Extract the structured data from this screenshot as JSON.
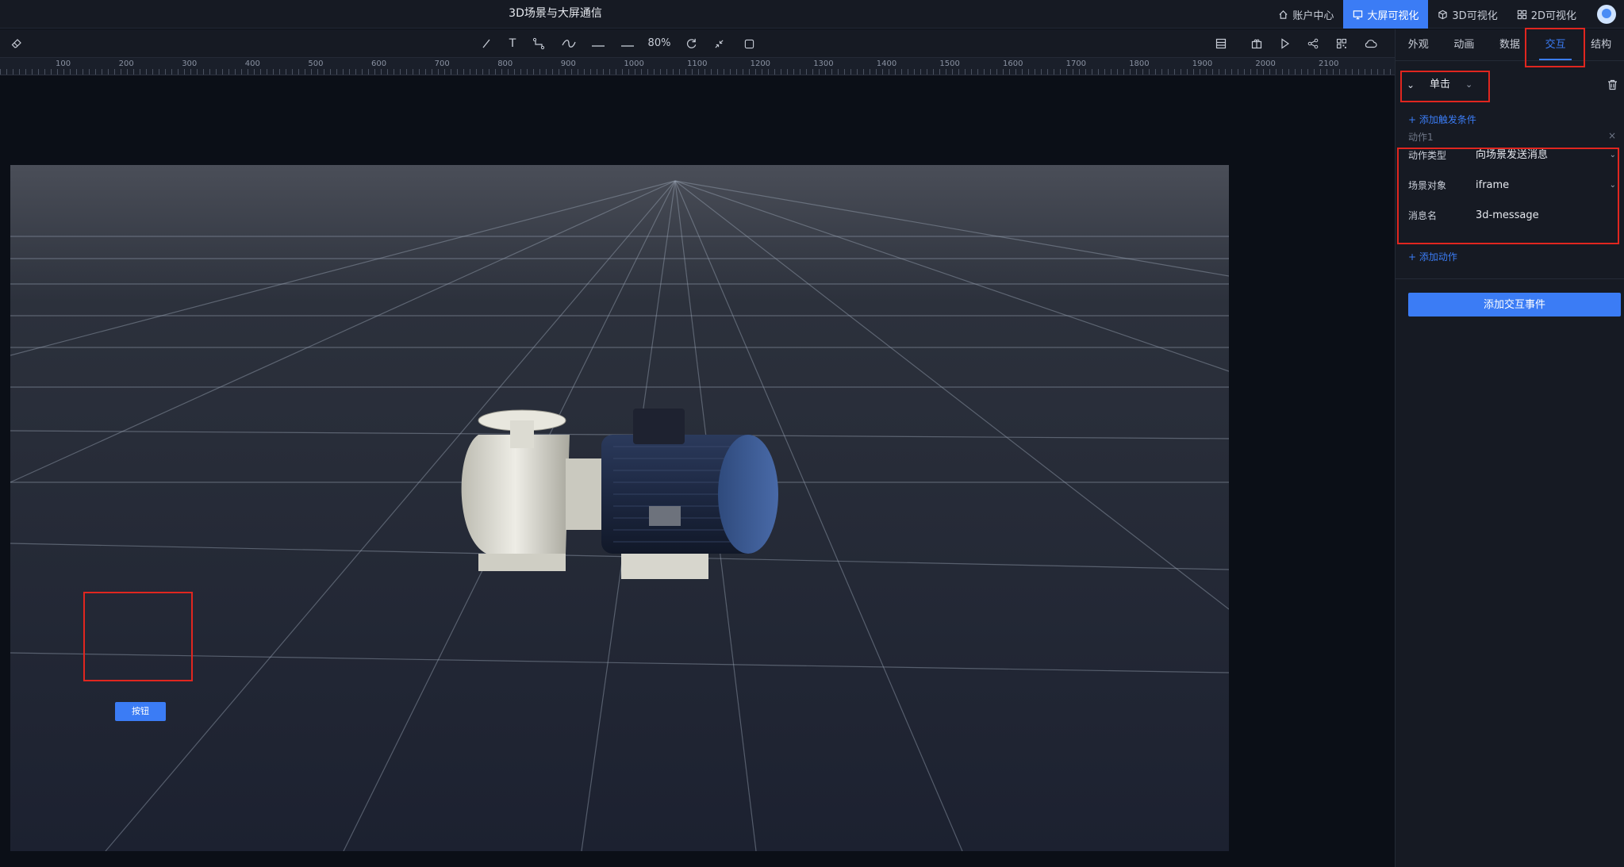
{
  "header": {
    "title": "3D场景与大屏通信",
    "nav": [
      {
        "label": "账户中心",
        "icon": "home-icon"
      },
      {
        "label": "大屏可视化",
        "icon": "monitor-icon",
        "active": true
      },
      {
        "label": "3D可视化",
        "icon": "cube-icon"
      },
      {
        "label": "2D可视化",
        "icon": "grid-icon"
      }
    ]
  },
  "toolbar": {
    "zoom": "80%",
    "icons": [
      "eraser-icon",
      "line-icon",
      "text-icon",
      "connector-icon",
      "curve-icon",
      "hline-icon",
      "dash-icon",
      "refresh-icon",
      "collapse-icon",
      "square-icon",
      "layout-icon",
      "gift-icon",
      "play-icon",
      "share-icon",
      "qrcode-icon",
      "cloud-icon"
    ]
  },
  "ruler": {
    "labels": [
      "100",
      "200",
      "300",
      "400",
      "500",
      "600",
      "700",
      "800",
      "900",
      "1000",
      "1100",
      "1200",
      "1300",
      "1400",
      "1500",
      "1600",
      "1700",
      "1800",
      "1900",
      "2000",
      "2100"
    ]
  },
  "scene": {
    "button_label": "按钮"
  },
  "panel": {
    "tabs": [
      {
        "label": "外观"
      },
      {
        "label": "动画"
      },
      {
        "label": "数据"
      },
      {
        "label": "交互",
        "active": true
      },
      {
        "label": "结构"
      }
    ],
    "trigger": "单击",
    "add_trigger_condition": "+ 添加触发条件",
    "action_title": "动作1",
    "fields": [
      {
        "label": "动作类型",
        "value": "向场景发送消息",
        "dropdown": true
      },
      {
        "label": "场景对象",
        "value": "iframe",
        "dropdown": true
      },
      {
        "label": "消息名",
        "value": "3d-message",
        "dropdown": false
      }
    ],
    "add_action": "+ 添加动作",
    "add_event_button": "添加交互事件"
  },
  "colors": {
    "accent": "#3b7cf5",
    "highlight": "#e0261f",
    "panel_bg": "#161a23",
    "scene_bg": "#212633"
  }
}
